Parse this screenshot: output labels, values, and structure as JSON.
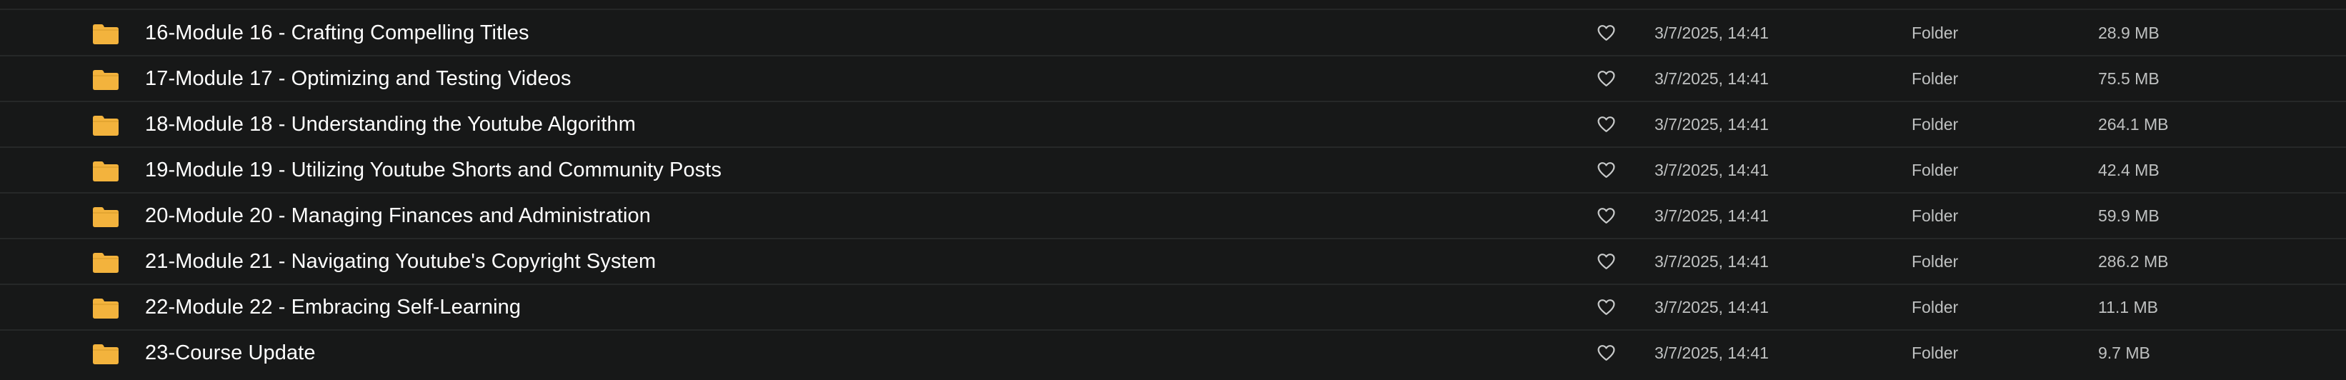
{
  "columns": {
    "favorite_icon": "heart-icon",
    "folder_icon": "folder-icon"
  },
  "colors": {
    "background": "#171818",
    "row_divider": "#262828",
    "name_text": "#ffffff",
    "meta_text": "#bfc1c1",
    "folder_fill": "#f3b33d"
  },
  "rows": [
    {
      "name": "16-Module 16 - Crafting Compelling Titles",
      "date": "3/7/2025, 14:41",
      "kind": "Folder",
      "size": "28.9 MB"
    },
    {
      "name": "17-Module 17 - Optimizing and Testing Videos",
      "date": "3/7/2025, 14:41",
      "kind": "Folder",
      "size": "75.5 MB"
    },
    {
      "name": "18-Module 18 - Understanding the Youtube Algorithm",
      "date": "3/7/2025, 14:41",
      "kind": "Folder",
      "size": "264.1 MB"
    },
    {
      "name": "19-Module 19 - Utilizing Youtube Shorts and Community Posts",
      "date": "3/7/2025, 14:41",
      "kind": "Folder",
      "size": "42.4 MB"
    },
    {
      "name": "20-Module 20 - Managing Finances and Administration",
      "date": "3/7/2025, 14:41",
      "kind": "Folder",
      "size": "59.9 MB"
    },
    {
      "name": "21-Module 21 - Navigating Youtube's Copyright System",
      "date": "3/7/2025, 14:41",
      "kind": "Folder",
      "size": "286.2 MB"
    },
    {
      "name": "22-Module 22 - Embracing Self-Learning",
      "date": "3/7/2025, 14:41",
      "kind": "Folder",
      "size": "11.1 MB"
    },
    {
      "name": "23-Course Update",
      "date": "3/7/2025, 14:41",
      "kind": "Folder",
      "size": "9.7 MB"
    }
  ]
}
